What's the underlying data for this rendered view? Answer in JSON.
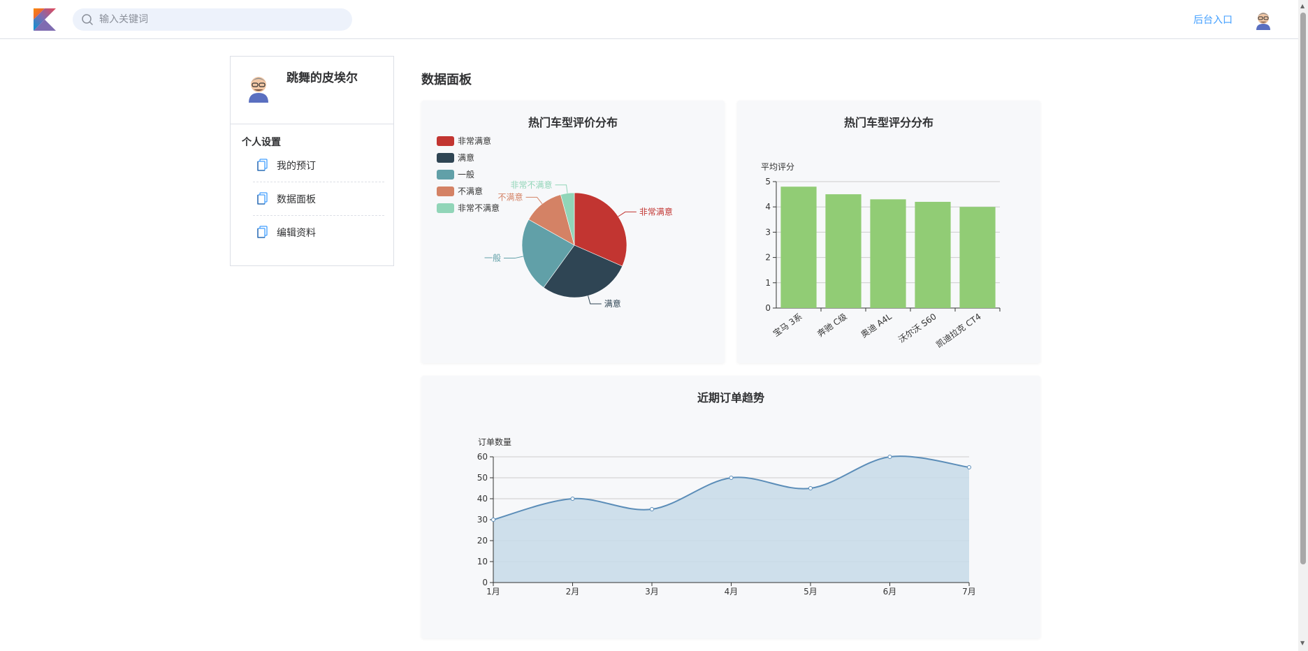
{
  "header": {
    "search_placeholder": "输入关键词",
    "admin_link": "后台入口",
    "logo": "kotlin-logo-icon",
    "avatar": "user-avatar"
  },
  "sidebar": {
    "user_name": "跳舞的皮埃尔",
    "section_title": "个人设置",
    "items": [
      {
        "label": "我的预订",
        "icon": "document-icon"
      },
      {
        "label": "数据面板",
        "icon": "document-icon"
      },
      {
        "label": "编辑资料",
        "icon": "document-icon"
      }
    ]
  },
  "main": {
    "title": "数据面板"
  },
  "colors": {
    "accent": "#409eff",
    "pie": [
      "#c23531",
      "#2f4554",
      "#61a0a8",
      "#d48265",
      "#91d5b8"
    ],
    "bar": "#91cc75",
    "line": "#5b8db8",
    "area": "#c7dae8"
  },
  "chart_data": [
    {
      "type": "pie",
      "title": "热门车型评价分布",
      "legend_position": "top-left",
      "categories": [
        "非常满意",
        "满意",
        "一般",
        "不满意",
        "非常不满意"
      ],
      "values": [
        30,
        27,
        22,
        12,
        4
      ],
      "labels": [
        "非常满意",
        "满意",
        "一般",
        "不满意",
        "非常不满意"
      ]
    },
    {
      "type": "bar",
      "title": "热门车型评分分布",
      "ylabel": "平均评分",
      "categories": [
        "宝马 3系",
        "奔驰 C级",
        "奥迪 A4L",
        "沃尔沃 S60",
        "凯迪拉克 CT4"
      ],
      "values": [
        4.8,
        4.5,
        4.3,
        4.2,
        4.0
      ],
      "ylim": [
        0,
        5
      ],
      "yticks": [
        "0",
        "1",
        "2",
        "3",
        "4",
        "5"
      ],
      "grid": true
    },
    {
      "type": "area",
      "title": "近期订单趋势",
      "ylabel": "订单数量",
      "categories": [
        "1月",
        "2月",
        "3月",
        "4月",
        "5月",
        "6月",
        "7月"
      ],
      "values": [
        30,
        40,
        35,
        50,
        45,
        60,
        55
      ],
      "ylim": [
        0,
        60
      ],
      "yticks": [
        "0",
        "10",
        "20",
        "30",
        "40",
        "50",
        "60"
      ],
      "grid": true
    }
  ]
}
